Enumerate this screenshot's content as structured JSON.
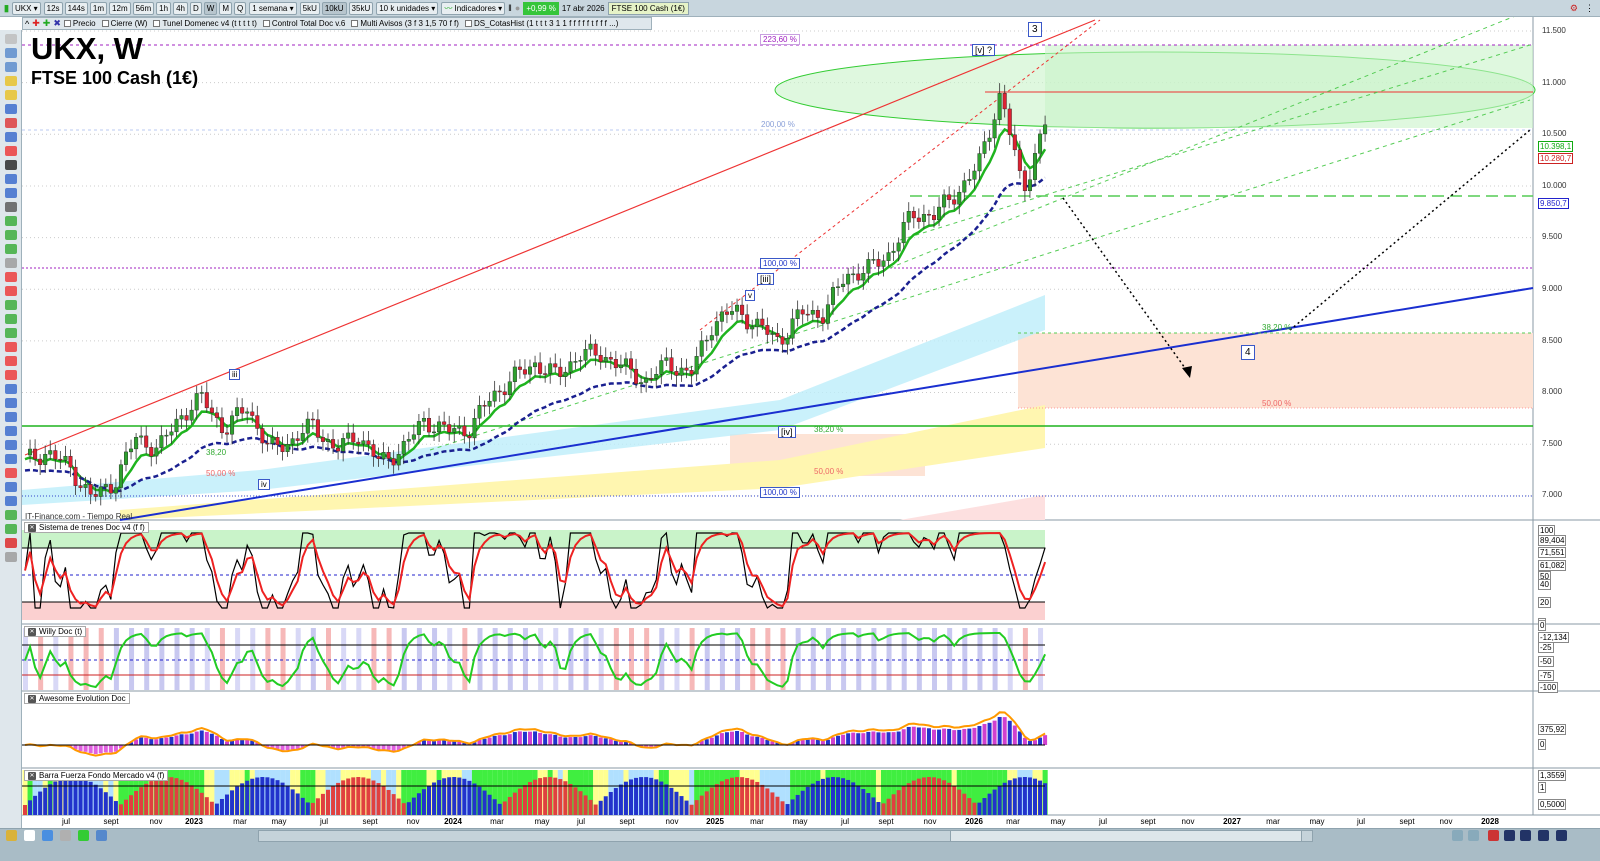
{
  "toolbar": {
    "symbol": "UKX",
    "timeframes": [
      "12s",
      "144s",
      "1m",
      "12m",
      "56m",
      "1h",
      "4h",
      "D",
      "W",
      "M",
      "Q"
    ],
    "active_timeframe": "W",
    "period": "1 semana",
    "units": [
      "5kU",
      "10kU",
      "35kU"
    ],
    "active_unit": "10kU",
    "units_select": "10 k unidades",
    "indicators_label": "Indicadores",
    "change": "+0,99 %",
    "date": "17 abr 2026",
    "instrument": "FTSE 100 Cash (1€)"
  },
  "legend": [
    "Precio",
    "Cierre (W)",
    "Tunel Domenec v4 (t t t t t)",
    "Control Total Doc v.6",
    "Multi Avisos (3 f 3 1,5 70 f f)",
    "DS_CotasHist (1 t t t 3 1 1 f f f f f t f f f ...)"
  ],
  "chart": {
    "title": "UKX, W",
    "subtitle": "FTSE 100 Cash (1€)",
    "source": "IT-Finance.com - Tiempo Real"
  },
  "annotations": {
    "fib_223": "223,60 %",
    "fib_200": "200,00 %",
    "fib_100a": "100,00 %",
    "fib_100b": "100,00 %",
    "fib_382a": "38,20 %",
    "fib_50a": "50,00 %",
    "fib_382b": "38,20 %",
    "fib_50b": "50,00 %",
    "fib_382c": "38,20",
    "fib_50c": "50,00 %",
    "wave_3": "3",
    "wave_v5": "[v] ?",
    "wave_iii_b": "[iii]",
    "wave_v": "v",
    "wave_iii": "iii",
    "wave_iv": "iv",
    "wave_iv_b": "[iv]",
    "wave_4": "4"
  },
  "price_tags": {
    "green": "10.398,1",
    "red": "10.280,7",
    "blue": "9.850,7"
  },
  "colors": {
    "green": "#1fb41f",
    "red": "#e02020",
    "blue": "#1a2fd0",
    "ma_dash": "#1a2090"
  },
  "price_axis": [
    "11.500",
    "11.000",
    "10.500",
    "10.000",
    "9.500",
    "9.000",
    "8.500",
    "8.000",
    "7.500",
    "7.000"
  ],
  "panels": [
    {
      "title": "Sistema de trenes Doc v4 (f f)",
      "ticks": [
        "100",
        "89,404",
        "71,551",
        "61,082",
        "50",
        "40",
        "20",
        "0"
      ]
    },
    {
      "title": "Willy Doc (t)",
      "ticks": [
        "0",
        "-12,134",
        "-25",
        "-50",
        "-75",
        "-100"
      ]
    },
    {
      "title": "Awesome Evolution Doc",
      "ticks": [
        "375,92",
        "0"
      ]
    },
    {
      "title": "Barra Fuerza Fondo Mercado v4 (f)",
      "ticks": [
        "1,3559",
        "1",
        "0,5000"
      ]
    }
  ],
  "x_axis": [
    "jul",
    "sept",
    "nov",
    "2023",
    "mar",
    "may",
    "jul",
    "sept",
    "nov",
    "2024",
    "mar",
    "may",
    "jul",
    "sept",
    "nov",
    "2025",
    "mar",
    "may",
    "jul",
    "sept",
    "nov",
    "2026",
    "mar",
    "may",
    "jul",
    "sept",
    "nov",
    "2027",
    "mar",
    "may",
    "jul",
    "sept",
    "nov",
    "2028"
  ],
  "chart_data": {
    "type": "candlestick",
    "title": "UKX, W",
    "ylabel": "Precio",
    "ylim": [
      6800,
      11700
    ],
    "months": [
      "2022-06",
      "2022-07",
      "2022-08",
      "2022-09",
      "2022-10",
      "2022-11",
      "2022-12",
      "2023-01",
      "2023-02",
      "2023-03",
      "2023-04",
      "2023-05",
      "2023-06",
      "2023-07",
      "2023-08",
      "2023-09",
      "2023-10",
      "2023-11",
      "2023-12",
      "2024-01",
      "2024-02",
      "2024-03",
      "2024-04",
      "2024-05",
      "2024-06",
      "2024-07",
      "2024-08",
      "2024-09",
      "2024-10",
      "2024-11",
      "2024-12",
      "2025-01",
      "2025-02",
      "2025-03",
      "2025-04",
      "2025-05",
      "2025-06",
      "2025-07",
      "2025-08",
      "2025-09",
      "2025-10",
      "2025-11",
      "2025-12",
      "2026-01",
      "2026-02",
      "2026-03",
      "2026-04"
    ],
    "closes": [
      7350,
      7420,
      7280,
      6980,
      7120,
      7560,
      7450,
      7770,
      7950,
      7630,
      7870,
      7450,
      7530,
      7690,
      7440,
      7600,
      7320,
      7450,
      7730,
      7630,
      7640,
      7950,
      8140,
      8280,
      8160,
      8370,
      8370,
      8240,
      8110,
      8290,
      8170,
      8670,
      8800,
      8650,
      8500,
      8770,
      8760,
      9130,
      9190,
      9350,
      9720,
      9720,
      9930,
      10200,
      10900,
      9950,
      10600
    ]
  }
}
